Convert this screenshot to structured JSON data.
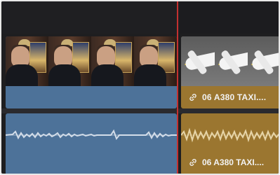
{
  "timeline": {
    "video_clip_b_label": "06 A380 TAXI....",
    "audio_clip_b_label": "06 A380 TAXI...."
  },
  "icons": {
    "link": "link-icon"
  },
  "colors": {
    "background": "#1e1e20",
    "clip_blue": "#4d7299",
    "clip_gold": "#9b7630",
    "playhead": "#c43030",
    "waveform": "#d9e2ec",
    "waveform_gold": "#efe0b6"
  }
}
